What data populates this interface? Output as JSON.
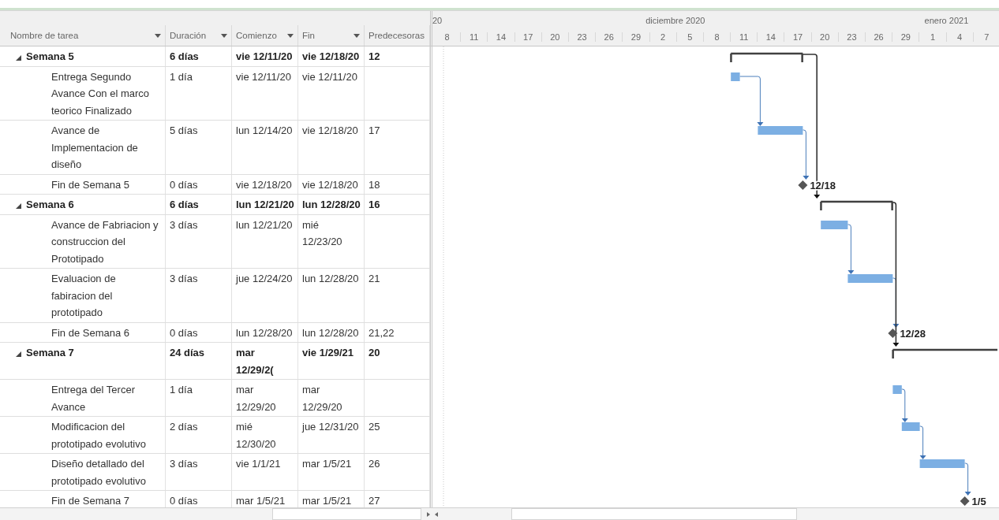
{
  "table": {
    "columns": [
      {
        "label": "Nombre de tarea",
        "dropdown": true
      },
      {
        "label": "Duración",
        "dropdown": true
      },
      {
        "label": "Comienzo",
        "dropdown": true
      },
      {
        "label": "Fin",
        "dropdown": true
      },
      {
        "label": "Predecesoras",
        "dropdown": false
      }
    ],
    "rows": [
      {
        "kind": "summary",
        "expanded": true,
        "name": "Semana 5",
        "duration": "6 días",
        "start": "vie 12/11/20",
        "finish": "vie 12/18/20",
        "predecessors": "12"
      },
      {
        "kind": "task",
        "name": "Entrega Segundo Avance Con el marco teorico Finalizado",
        "duration": "1 día",
        "start": "vie 12/11/20",
        "finish": "vie 12/11/20",
        "predecessors": ""
      },
      {
        "kind": "task",
        "name": "Avance de Implementacion de diseño",
        "duration": "5 días",
        "start": "lun 12/14/20",
        "finish": "vie 12/18/20",
        "predecessors": "17"
      },
      {
        "kind": "milestone",
        "name": "Fin de Semana 5",
        "duration": "0 días",
        "start": "vie 12/18/20",
        "finish": "vie 12/18/20",
        "predecessors": "18",
        "milestone_label": "12/18"
      },
      {
        "kind": "summary",
        "expanded": true,
        "name": "Semana 6",
        "duration": "6 días",
        "start": "lun 12/21/20",
        "finish": "lun 12/28/20",
        "predecessors": "16"
      },
      {
        "kind": "task",
        "name": "Avance de Fabriacion y construccion del Prototipado",
        "duration": "3 días",
        "start": "lun 12/21/20",
        "finish": "mié 12/23/20",
        "predecessors": ""
      },
      {
        "kind": "task",
        "name": "Evaluacion de fabiracion del prototipado",
        "duration": "3 días",
        "start": "jue 12/24/20",
        "finish": "lun 12/28/20",
        "predecessors": "21"
      },
      {
        "kind": "milestone",
        "name": "Fin de Semana 6",
        "duration": "0 días",
        "start": "lun 12/28/20",
        "finish": "lun 12/28/20",
        "predecessors": "21,22",
        "milestone_label": "12/28"
      },
      {
        "kind": "summary",
        "expanded": true,
        "name": "Semana 7",
        "duration": "24 días",
        "start": "mar 12/29/2(",
        "finish": "vie 1/29/21",
        "predecessors": "20"
      },
      {
        "kind": "task",
        "name": "Entrega del Tercer Avance",
        "duration": "1 día",
        "start": "mar 12/29/20",
        "finish": "mar 12/29/20",
        "predecessors": ""
      },
      {
        "kind": "task",
        "name": "Modificacion del prototipado evolutivo",
        "duration": "2 días",
        "start": "mié 12/30/20",
        "finish": "jue 12/31/20",
        "predecessors": "25"
      },
      {
        "kind": "task",
        "name": "Diseño detallado del prototipado evolutivo",
        "duration": "3 días",
        "start": "vie 1/1/21",
        "finish": "mar 1/5/21",
        "predecessors": "26"
      },
      {
        "kind": "milestone",
        "name": "Fin de Semana 7",
        "duration": "0 días",
        "start": "mar 1/5/21",
        "finish": "mar 1/5/21",
        "predecessors": "27",
        "milestone_label": "1/5"
      }
    ]
  },
  "timescale": {
    "months": [
      "20",
      "diciembre 2020",
      "enero 2021"
    ],
    "days": [
      "8",
      "11",
      "14",
      "17",
      "20",
      "23",
      "26",
      "29",
      "2",
      "5",
      "8",
      "11",
      "14",
      "17",
      "20",
      "23",
      "26",
      "29",
      "1",
      "4",
      "7"
    ]
  }
}
